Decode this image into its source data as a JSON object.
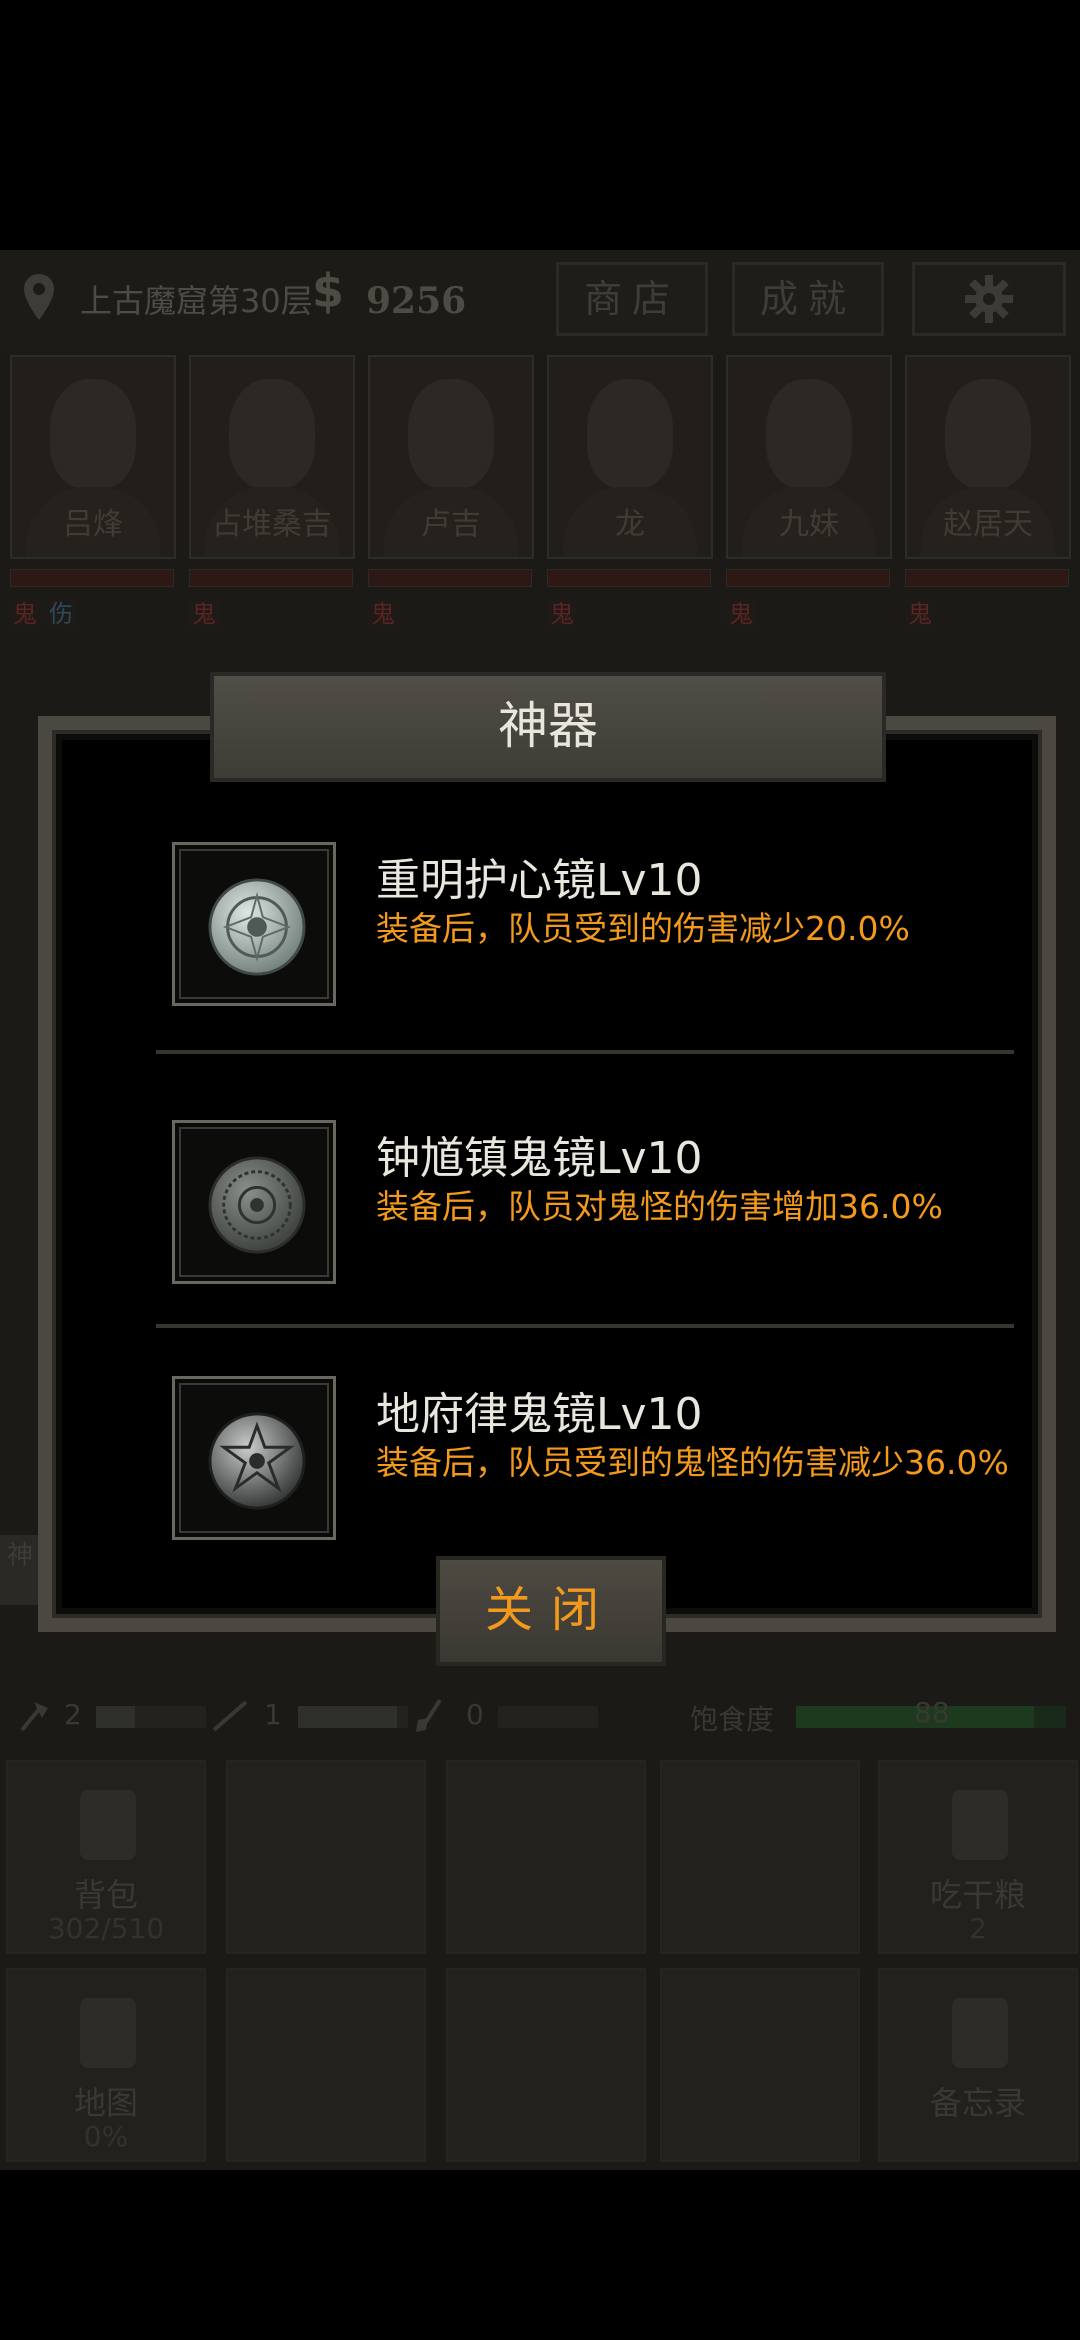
{
  "topbar": {
    "location": "上古魔窟第30层",
    "money_symbol": "$",
    "money": "9256",
    "shop_label": "商店",
    "achievements_label": "成就",
    "settings_icon": "gear-icon"
  },
  "characters": [
    {
      "name": "吕烽",
      "tags": [
        "鬼",
        "伤"
      ]
    },
    {
      "name": "占堆桑吉",
      "tags": [
        "鬼"
      ]
    },
    {
      "name": "卢吉",
      "tags": [
        "鬼"
      ]
    },
    {
      "name": "龙",
      "tags": [
        "鬼"
      ]
    },
    {
      "name": "九妹",
      "tags": [
        "鬼"
      ]
    },
    {
      "name": "赵居天",
      "tags": [
        "鬼"
      ]
    }
  ],
  "side_chip": "神",
  "resources": {
    "axe": "2",
    "stick": "1",
    "shovel": "0",
    "satiety_label": "饱食度",
    "satiety_value": "88"
  },
  "grid": {
    "backpack_label": "背包",
    "backpack_count": "302/510",
    "eat_label": "吃干粮",
    "eat_count": "2",
    "map_label": "地图",
    "map_pct": "0%",
    "memo_label": "备忘录"
  },
  "dialog": {
    "title": "神器",
    "items": [
      {
        "name": "重明护心镜Lv10",
        "desc": "装备后，队员受到的伤害减少20.0%"
      },
      {
        "name": "钟馗镇鬼镜Lv10",
        "desc": "装备后，队员对鬼怪的伤害增加36.0%"
      },
      {
        "name": "地府律鬼镜Lv10",
        "desc": "装备后，队员受到的鬼怪的伤害减少36.0%"
      }
    ],
    "close_label": "关闭"
  },
  "colors": {
    "accent_orange": "#f39a1c",
    "title_text": "#e9e6dd",
    "frame": "#4a4840"
  }
}
